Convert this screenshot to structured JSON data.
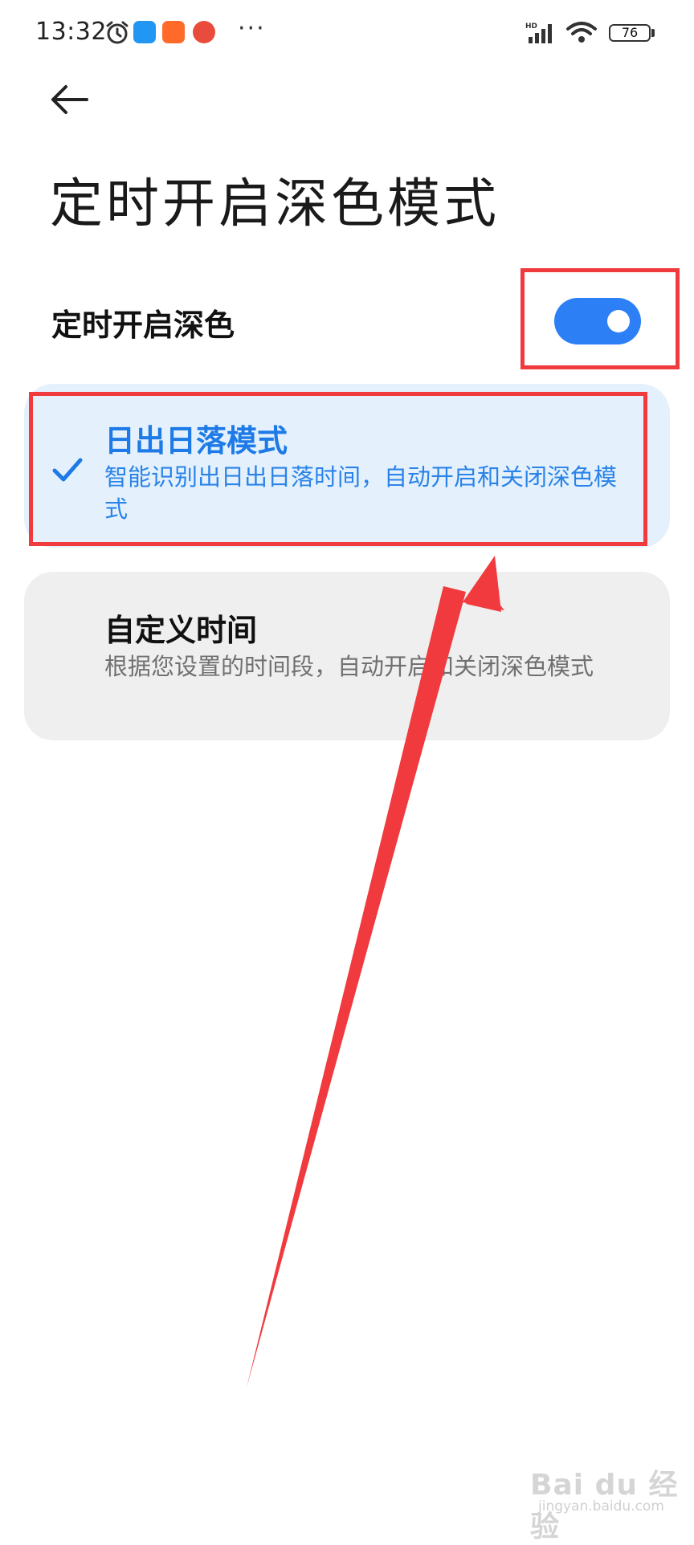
{
  "status_bar": {
    "time": "13:32",
    "more": "···",
    "battery": "76",
    "app_icon_colors": [
      "#2196f3",
      "#ff6a2a",
      "#e94b3c"
    ]
  },
  "header": {
    "title": "定时开启深色模式"
  },
  "schedule_toggle": {
    "label": "定时开启深色",
    "on": true,
    "accent_color": "#2d7ff6"
  },
  "options": [
    {
      "title": "日出日落模式",
      "description": "智能识别出日出日落时间，自动开启和关闭深色模式",
      "selected": true
    },
    {
      "title": "自定义时间",
      "description": "根据您设置的时间段，自动开启和关闭深色模式",
      "selected": false
    }
  ],
  "annotation": {
    "highlight_color": "#f03a3e"
  },
  "watermark": {
    "brand": "Bai du 经验",
    "url": "jingyan.baidu.com"
  }
}
